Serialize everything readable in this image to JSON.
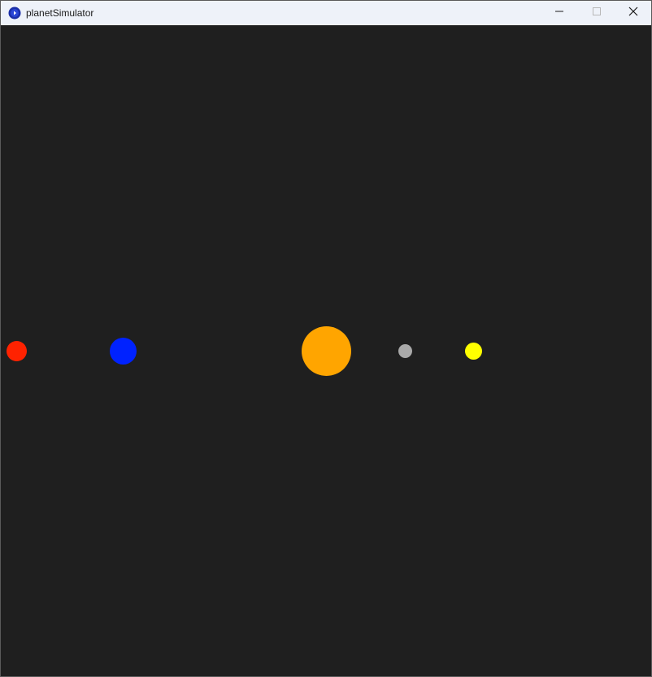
{
  "window": {
    "title": "planetSimulator",
    "icon": "app-logo-icon",
    "controls": {
      "minimize_icon": "minimize-icon",
      "maximize_icon": "maximize-icon",
      "close_icon": "close-icon"
    }
  },
  "simulation": {
    "background_color": "#1f1f1f",
    "bodies": [
      {
        "name": "red-planet",
        "color": "#ff2200"
      },
      {
        "name": "blue-planet",
        "color": "#0022ff"
      },
      {
        "name": "sun",
        "color": "#ffa500"
      },
      {
        "name": "gray-planet",
        "color": "#a9a9a9"
      },
      {
        "name": "yellow-planet",
        "color": "#ffff00"
      }
    ]
  }
}
